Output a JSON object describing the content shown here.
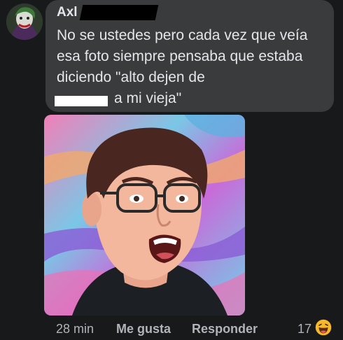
{
  "comment": {
    "author": "Axl",
    "text": "No se ustedes pero cada vez que veía esa foto siempre pensaba que estaba diciendo \"alto dejen de",
    "text_end": "a mi vieja\""
  },
  "actions": {
    "time": "28 min",
    "like": "Me gusta",
    "reply": "Responder"
  },
  "reactions": {
    "count": "17",
    "icon": "haha-emoji-icon",
    "color": "#f7b928"
  }
}
